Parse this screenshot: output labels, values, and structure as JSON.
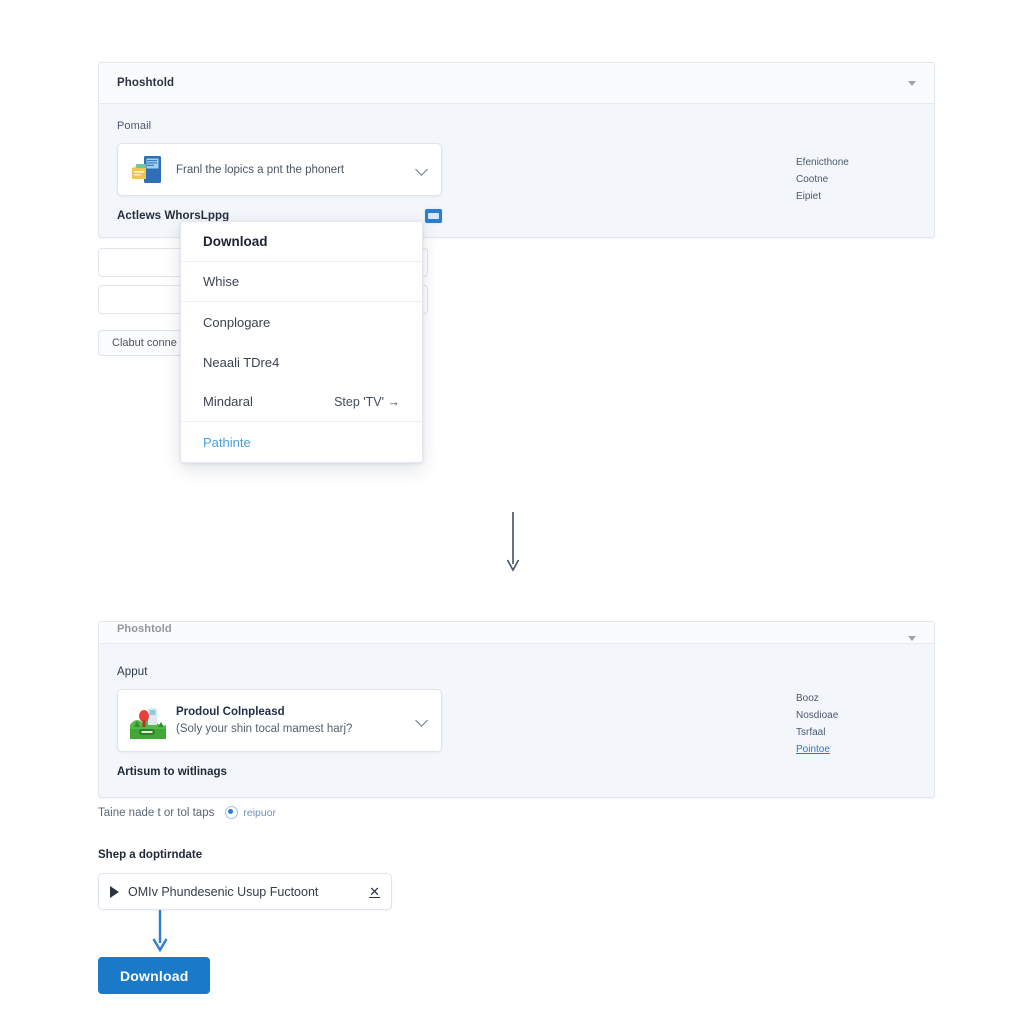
{
  "top_panel": {
    "header_title": "Phoshtold",
    "field_label": "Pomail",
    "card": {
      "text": "Franl the lopics a pnt the phonert",
      "icon": "document-phone-icon",
      "chevron": "chevron-down-icon"
    },
    "file_name": "Actlews WhorsLppg",
    "file_badge_icon": "image-badge-icon",
    "meta": [
      {
        "label": "Efenicthone",
        "link": false
      },
      {
        "label": "Cootne",
        "link": false
      },
      {
        "label": "Eipiet",
        "link": false
      }
    ]
  },
  "background_form": {
    "input_1_value": "",
    "input_2_value": "",
    "button_label": "Clabut conne"
  },
  "menu": {
    "items": [
      {
        "label": "Download",
        "kind": "head",
        "right": ""
      },
      {
        "label": "Whise",
        "kind": "item-sep",
        "right": ""
      },
      {
        "label": "Conplogare",
        "kind": "item",
        "right": ""
      },
      {
        "label": "Neaali TDre4",
        "kind": "item",
        "right": ""
      },
      {
        "label": "Mindaral",
        "kind": "item-sep",
        "right": "Step 'TV' →"
      },
      {
        "label": "Pathinte",
        "kind": "link",
        "right": ""
      }
    ]
  },
  "connector_arrow": {
    "name": "flow-arrow-down",
    "color": "#4d5a6b"
  },
  "bottom_panel": {
    "header_title": "Phoshtold",
    "field_label": "Apput",
    "card": {
      "title": "Prodoul Colnpleasd",
      "subtitle": "(Soly your shin tocal mamest harj?",
      "icon": "landscape-green-icon",
      "chevron": "chevron-down-icon"
    },
    "section_note": "Artisum to witlinags",
    "meta": [
      {
        "label": "Booz",
        "link": false
      },
      {
        "label": "Nosdioae",
        "link": false
      },
      {
        "label": "Tsrfaal",
        "link": false
      },
      {
        "label": "Pointoe",
        "link": true
      }
    ]
  },
  "bottom_controls": {
    "radio_text": "Taine nade t or tol taps",
    "radio_label": "reipuor",
    "sub_head": "Shep a doptirndate",
    "token": {
      "play_icon": "play-icon",
      "text": "OMIv Phundesenic Usup Fuctoont",
      "remove_icon": "close-x-icon"
    },
    "arrow": {
      "name": "blue-arrow-down",
      "color": "#2d7dd2"
    },
    "download_button": "Download"
  },
  "colors": {
    "accent_blue": "#1b7ac8",
    "panel_bg": "#f3f6fa",
    "link_blue": "#2e77c6",
    "menu_link": "#4d9fd6"
  }
}
